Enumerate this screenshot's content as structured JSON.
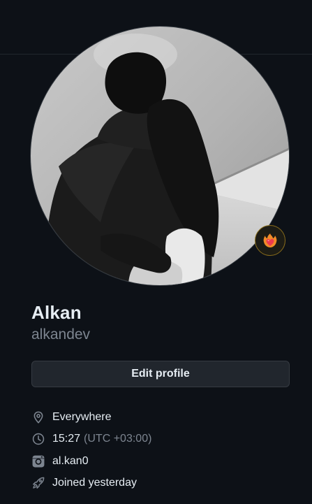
{
  "profile": {
    "display_name": "Alkan",
    "username": "alkandev",
    "edit_label": "Edit profile"
  },
  "details": {
    "location": "Everywhere",
    "local_time": "15:27",
    "timezone": "(UTC +03:00)",
    "instagram": "al.kan0",
    "joined": "Joined yesterday"
  },
  "icons": {
    "location": "location-pin-icon",
    "time": "clock-icon",
    "instagram": "instagram-icon",
    "joined": "rocket-icon",
    "status": "heart-on-fire-emoji-icon"
  },
  "colors": {
    "background": "#0d1117",
    "text": "#e6edf3",
    "muted": "#7d8590",
    "button_bg": "#21262d",
    "border": "#30363d"
  }
}
